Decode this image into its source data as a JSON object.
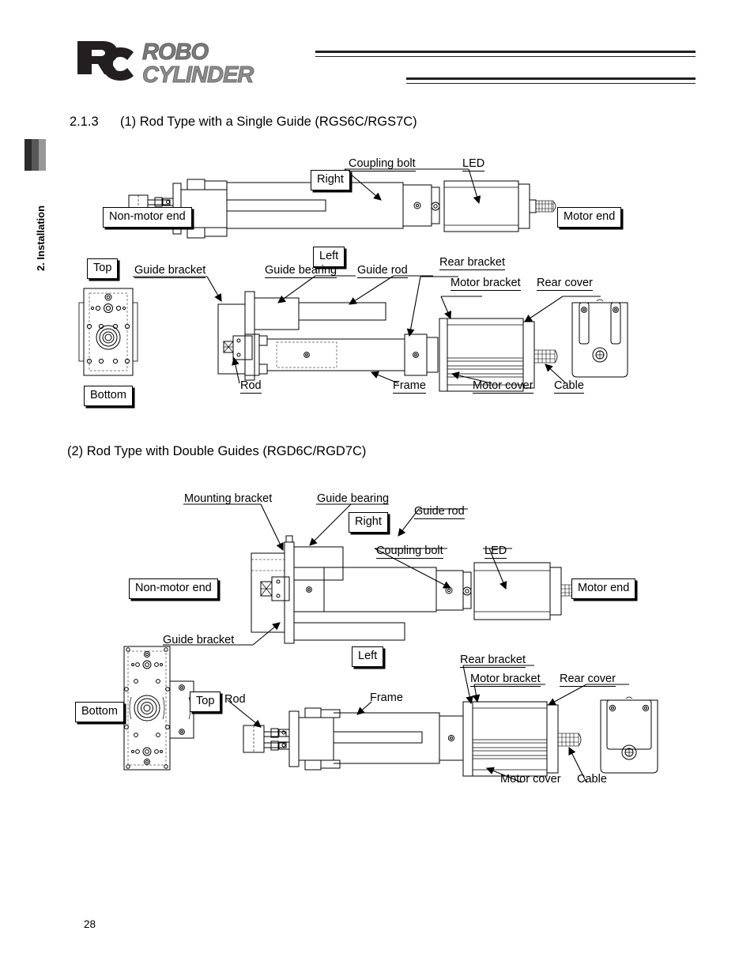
{
  "header": {
    "logo_line1": "ROBO",
    "logo_line2": "CYLINDER",
    "logo_mark": "rc-logo-icon"
  },
  "sidebar": {
    "label": "2. Installation"
  },
  "section": {
    "number": "2.1.3",
    "title": "(1) Rod Type with a Single Guide (RGS6C/RGS7C)",
    "title2": "(2) Rod Type with Double Guides (RGD6C/RGD7C)"
  },
  "page_number": "28",
  "figure1": {
    "name": "rod-type-single-guide-diagram",
    "boxed_labels": [
      {
        "id": "right",
        "text": "Right"
      },
      {
        "id": "non-motor-end",
        "text": "Non-motor end"
      },
      {
        "id": "left",
        "text": "Left"
      },
      {
        "id": "motor-end",
        "text": "Motor end"
      },
      {
        "id": "top",
        "text": "Top"
      },
      {
        "id": "bottom",
        "text": "Bottom"
      }
    ],
    "callouts": [
      {
        "id": "coupling-bolt",
        "text": "Coupling bolt"
      },
      {
        "id": "led",
        "text": "LED"
      },
      {
        "id": "guide-bracket",
        "text": "Guide bracket"
      },
      {
        "id": "guide-bearing",
        "text": "Guide bearing"
      },
      {
        "id": "guide-rod",
        "text": "Guide rod"
      },
      {
        "id": "rear-bracket",
        "text": "Rear bracket"
      },
      {
        "id": "motor-bracket",
        "text": "Motor bracket"
      },
      {
        "id": "rear-cover",
        "text": "Rear cover"
      },
      {
        "id": "rod",
        "text": "Rod"
      },
      {
        "id": "frame",
        "text": "Frame"
      },
      {
        "id": "motor-cover",
        "text": "Motor cover"
      },
      {
        "id": "cable",
        "text": "Cable"
      }
    ]
  },
  "figure2": {
    "name": "rod-type-double-guides-diagram",
    "boxed_labels": [
      {
        "id": "right",
        "text": "Right"
      },
      {
        "id": "non-motor-end",
        "text": "Non-motor end"
      },
      {
        "id": "left",
        "text": "Left"
      },
      {
        "id": "motor-end",
        "text": "Motor end"
      },
      {
        "id": "top",
        "text": "Top"
      },
      {
        "id": "bottom",
        "text": "Bottom"
      }
    ],
    "callouts": [
      {
        "id": "mounting-bracket",
        "text": "Mounting bracket"
      },
      {
        "id": "guide-bearing",
        "text": "Guide bearing"
      },
      {
        "id": "guide-rod",
        "text": "Guide rod"
      },
      {
        "id": "coupling-bolt",
        "text": "Coupling bolt"
      },
      {
        "id": "led",
        "text": "LED"
      },
      {
        "id": "guide-bracket",
        "text": "Guide bracket"
      },
      {
        "id": "rod",
        "text": "Rod"
      },
      {
        "id": "frame",
        "text": "Frame"
      },
      {
        "id": "rear-bracket",
        "text": "Rear bracket"
      },
      {
        "id": "motor-bracket",
        "text": "Motor bracket"
      },
      {
        "id": "rear-cover",
        "text": "Rear cover"
      },
      {
        "id": "motor-cover",
        "text": "Motor cover"
      },
      {
        "id": "cable",
        "text": "Cable"
      }
    ]
  },
  "colors": {
    "ink": "#000000",
    "logo_gray": "#8d8d8d",
    "rule_dark": "#231f20",
    "tab_dark": "#2b2b2b",
    "tab_mid": "#585858",
    "tab_light": "#989898"
  }
}
